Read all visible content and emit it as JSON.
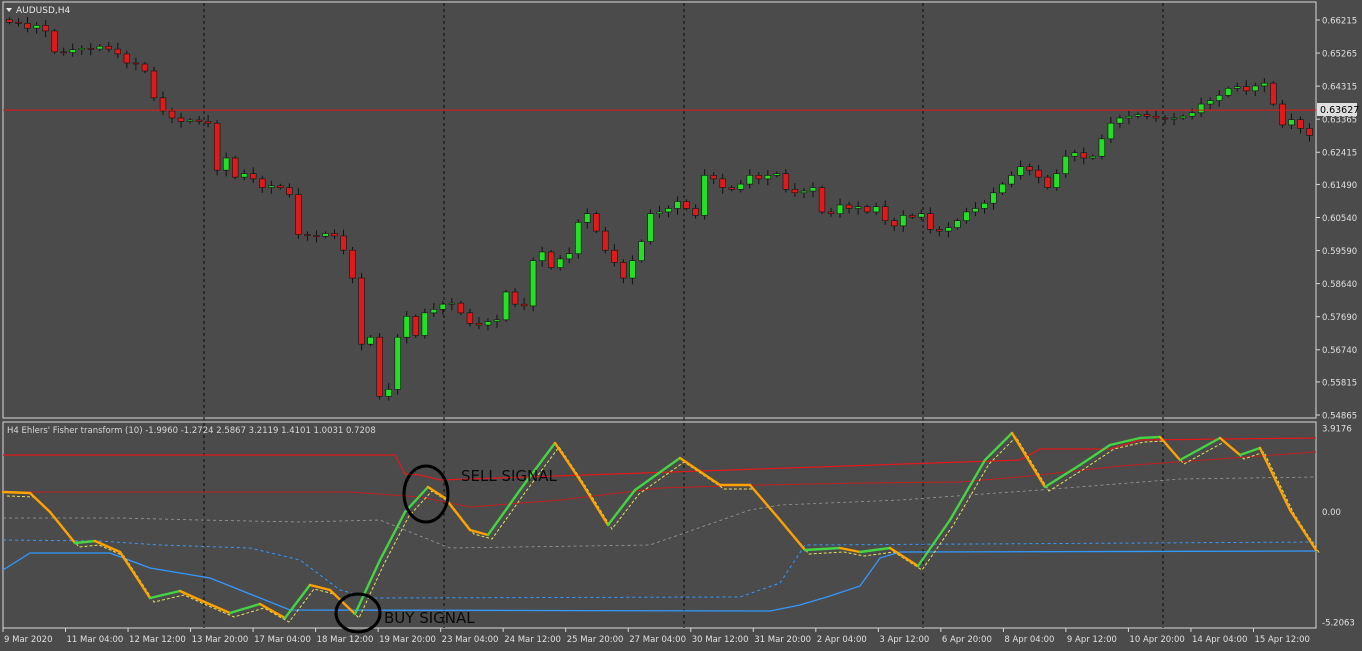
{
  "window": {
    "symbol_title": "AUDUSD,H4",
    "menu_arrow_icon": "triangle-down-icon"
  },
  "price_panel": {
    "price_ticks": [
      "0.66215",
      "0.65265",
      "0.64315",
      "0.63365",
      "0.62415",
      "0.61490",
      "0.60540",
      "0.59590",
      "0.58640",
      "0.57690",
      "0.56740",
      "0.55815",
      "0.54865"
    ],
    "current_price": "0.63627",
    "current_price_line_color": "#e01a1a",
    "bull_candle_color": "#22e022",
    "bear_candle_color": "#e01a1a"
  },
  "indicator_panel": {
    "title": "H4 Ehlers' Fisher transform (10) -1.9960 -1.2724 2.5867 3.2119 1.4101 1.0031 0.7208",
    "value_ticks": [
      "3.9176",
      "0.00",
      "-5.2063"
    ],
    "annotations": {
      "sell": "SELL SIGNAL",
      "buy": "BUY SIGNAL"
    },
    "fisher_colors": {
      "rising": "#44d444",
      "falling": "#ffa200",
      "trigger": "#e8e060"
    },
    "level_colors": {
      "upper": "#e01a1a",
      "lower": "#3399ff",
      "mid": "#9a9a9a"
    }
  },
  "time_axis": {
    "labels": [
      "9 Mar 2020",
      "11 Mar 04:00",
      "12 Mar 12:00",
      "13 Mar 20:00",
      "17 Mar 04:00",
      "18 Mar 12:00",
      "19 Mar 20:00",
      "23 Mar 04:00",
      "24 Mar 12:00",
      "25 Mar 20:00",
      "27 Mar 04:00",
      "30 Mar 12:00",
      "31 Mar 20:00",
      "2 Apr 04:00",
      "3 Apr 12:00",
      "6 Apr 20:00",
      "8 Apr 04:00",
      "9 Apr 12:00",
      "10 Apr 20:00",
      "14 Apr 04:00",
      "15 Apr 12:00"
    ]
  },
  "chart_data": {
    "type": "candlestick",
    "symbol": "AUDUSD",
    "timeframe": "H4",
    "closes": [
      0.6615,
      0.6612,
      0.6598,
      0.6606,
      0.659,
      0.653,
      0.6528,
      0.6536,
      0.654,
      0.6538,
      0.6546,
      0.6538,
      0.6524,
      0.6498,
      0.6495,
      0.6475,
      0.6398,
      0.636,
      0.634,
      0.633,
      0.6334,
      0.633,
      0.6325,
      0.619,
      0.6225,
      0.617,
      0.618,
      0.6165,
      0.614,
      0.6145,
      0.614,
      0.612,
      0.6005,
      0.6002,
      0.6,
      0.6008,
      0.6001,
      0.596,
      0.588,
      0.569,
      0.571,
      0.554,
      0.556,
      0.571,
      0.577,
      0.5715,
      0.578,
      0.579,
      0.5805,
      0.5808,
      0.578,
      0.575,
      0.5745,
      0.5755,
      0.576,
      0.584,
      0.5805,
      0.58,
      0.593,
      0.5955,
      0.591,
      0.5935,
      0.595,
      0.604,
      0.6065,
      0.6015,
      0.596,
      0.5925,
      0.588,
      0.593,
      0.5985,
      0.6065,
      0.607,
      0.608,
      0.61,
      0.608,
      0.606,
      0.6175,
      0.6165,
      0.614,
      0.6135,
      0.615,
      0.6175,
      0.6165,
      0.6175,
      0.618,
      0.6135,
      0.6125,
      0.613,
      0.614,
      0.607,
      0.6065,
      0.609,
      0.608,
      0.6085,
      0.607,
      0.6085,
      0.6045,
      0.603,
      0.606,
      0.6055,
      0.6065,
      0.602,
      0.6015,
      0.6025,
      0.6045,
      0.607,
      0.608,
      0.6095,
      0.6125,
      0.615,
      0.6175,
      0.62,
      0.619,
      0.617,
      0.614,
      0.618,
      0.623,
      0.624,
      0.6225,
      0.623,
      0.628,
      0.6325,
      0.634,
      0.6345,
      0.635,
      0.6345,
      0.634,
      0.6337,
      0.634,
      0.6345,
      0.6355,
      0.638,
      0.639,
      0.6405,
      0.6425,
      0.643,
      0.6418,
      0.6432,
      0.644,
      0.638,
      0.632,
      0.6335,
      0.631,
      0.629
    ],
    "current_price": 0.63627,
    "ylim": [
      0.54865,
      0.66215
    ],
    "indicator": {
      "name": "Ehlers' Fisher transform (10)",
      "values_shown": [
        -1.996,
        -1.2724,
        2.5867,
        3.2119,
        1.4101,
        1.0031,
        0.7208
      ],
      "ylim": [
        -5.2063,
        3.9176
      ]
    }
  }
}
